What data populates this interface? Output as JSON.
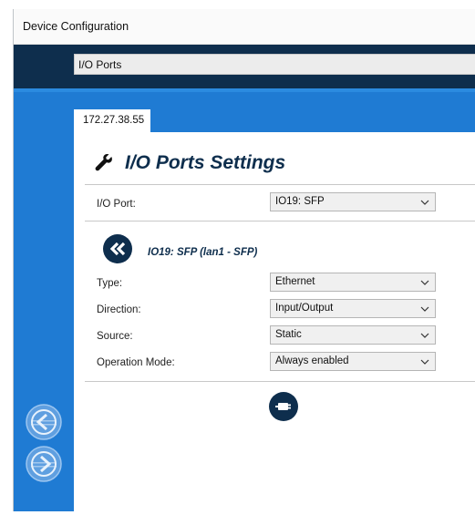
{
  "window": {
    "title": "Device Configuration"
  },
  "nav": {
    "path": "I/O Ports"
  },
  "tab": {
    "label": "172.27.38.55"
  },
  "page": {
    "title": "I/O Ports Settings"
  },
  "io_port": {
    "label": "I/O Port:",
    "value": "IO19: SFP"
  },
  "port_detail": {
    "title": "IO19: SFP (lan1 - SFP)"
  },
  "fields": {
    "type": {
      "label": "Type:",
      "value": "Ethernet"
    },
    "direction": {
      "label": "Direction:",
      "value": "Input/Output"
    },
    "source": {
      "label": "Source:",
      "value": "Static"
    },
    "operation_mode": {
      "label": "Operation Mode:",
      "value": "Always enabled"
    }
  },
  "colors": {
    "navy": "#0e2e4d",
    "blue": "#1f7bd3"
  },
  "icons": {
    "heading": "wrench-icon",
    "back": "double-chevron-left-icon",
    "apply": "plug-icon",
    "side_prev": "circle-arrow-left-icon",
    "side_next": "circle-arrow-right-icon"
  }
}
